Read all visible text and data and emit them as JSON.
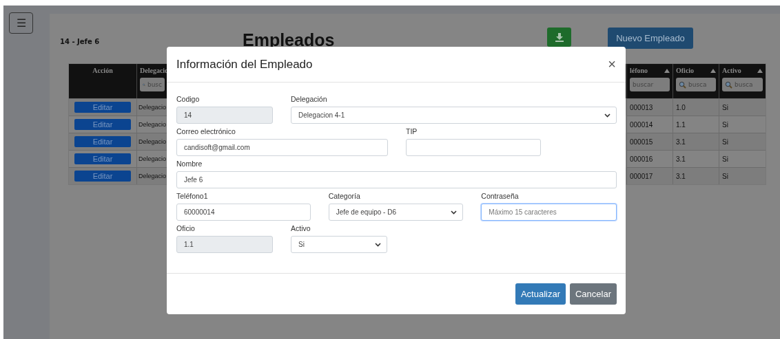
{
  "menu_button": {
    "label": "☰"
  },
  "header": {
    "user": "14 - Jefe 6",
    "title": "Empleados",
    "new_button": "Nuevo Empleado"
  },
  "table": {
    "columns": [
      {
        "label": "Acción"
      },
      {
        "label": "Delegacio",
        "search": "busc"
      },
      {
        "label": "léfono",
        "sortable": true,
        "search": "buscar"
      },
      {
        "label": "Oficio",
        "sortable": true,
        "search": "busca"
      },
      {
        "label": "Activo",
        "sortable": true,
        "search": "busca"
      }
    ],
    "rows": [
      {
        "action": "Editar",
        "delegacion": "Delegacio",
        "telefono": "000013",
        "oficio": "1.0",
        "activo": "Si"
      },
      {
        "action": "Editar",
        "delegacion": "Delegacio",
        "telefono": "000014",
        "oficio": "1.1",
        "activo": "Si"
      },
      {
        "action": "Editar",
        "delegacion": "Delegacio",
        "telefono": "000015",
        "oficio": "3.1",
        "activo": "Si"
      },
      {
        "action": "Editar",
        "delegacion": "Delegacio",
        "telefono": "000016",
        "oficio": "3.1",
        "activo": "Si"
      },
      {
        "action": "Editar",
        "delegacion": "Delegacio",
        "telefono": "000017",
        "oficio": "3.1",
        "activo": "Si"
      }
    ]
  },
  "modal": {
    "title": "Información del Empleado",
    "close": "×",
    "rows": [
      [
        {
          "kind": "text",
          "label": "Codigo",
          "value": "14",
          "disabled": true,
          "focused": false
        },
        {
          "kind": "select",
          "label": "Delegación",
          "value": "Delegacion 4-1",
          "disabled": false,
          "focused": false
        }
      ],
      [
        {
          "kind": "text",
          "label": "Correo electrónico",
          "value": "candisoft@gmail.com",
          "disabled": false,
          "focused": false
        },
        {
          "kind": "text",
          "label": "TIP",
          "disabled": false,
          "focused": false
        }
      ],
      [
        {
          "kind": "text",
          "label": "Nombre",
          "value": "Jefe 6",
          "disabled": false,
          "focused": false
        }
      ],
      [
        {
          "kind": "text",
          "label": "Teléfono1",
          "value": "60000014",
          "disabled": false,
          "focused": false
        },
        {
          "kind": "select",
          "label": "Categoría",
          "value": "Jefe de equipo - D6",
          "disabled": false,
          "focused": false
        },
        {
          "kind": "password",
          "label": "Contraseña",
          "placeholder": "Máximo 15 caracteres",
          "disabled": false,
          "focused": true
        }
      ],
      [
        {
          "kind": "text",
          "label": "Oficio",
          "value": "1.1",
          "disabled": true,
          "focused": false
        },
        {
          "kind": "select",
          "label": "Activo",
          "value": "Si",
          "disabled": false,
          "focused": false
        }
      ]
    ],
    "buttons": [
      {
        "label": "Actualizar",
        "kind": "primary"
      },
      {
        "label": "Cancelar",
        "kind": "secondary"
      }
    ]
  }
}
